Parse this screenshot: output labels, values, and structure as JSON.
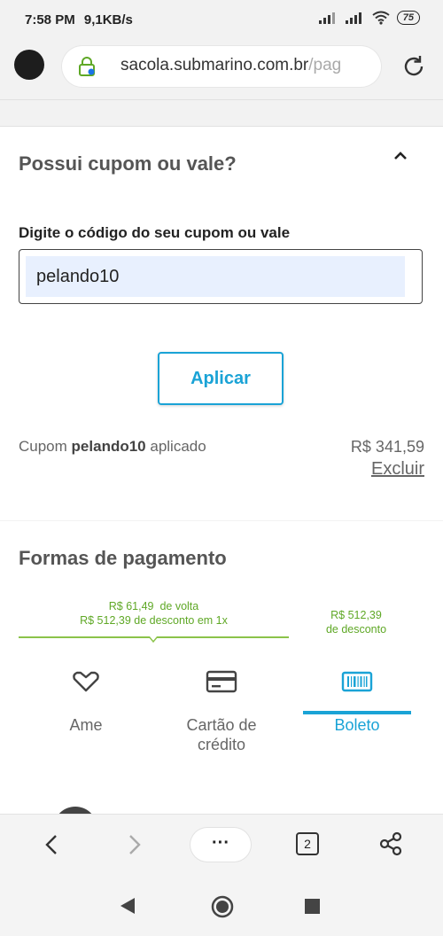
{
  "status_bar": {
    "time": "7:58 PM",
    "network_speed": "9,1KB/s",
    "battery": "75"
  },
  "browser": {
    "url_main": "sacola.submarino.com.br",
    "url_rest": "/pag"
  },
  "coupon": {
    "title": "Possui cupom ou vale?",
    "field_label": "Digite o código do seu cupom ou vale",
    "field_value": "pelando10",
    "apply_label": "Aplicar",
    "applied_prefix": "Cupom",
    "applied_code": "pelando10",
    "applied_suffix": "aplicado",
    "applied_value": "R$ 341,59",
    "remove_label": "Excluir"
  },
  "payment": {
    "title": "Formas de pagamento",
    "ame_promo_cashback": "R$ 61,49",
    "ame_promo_cashback_suffix": "de volta",
    "ame_promo_discount": "R$ 512,39 de desconto em 1x",
    "boleto_promo_value": "R$ 512,39",
    "boleto_promo_suffix": "de desconto",
    "tabs": [
      {
        "label": "Ame",
        "icon": "ame-heart-icon"
      },
      {
        "label": "Cartão de crédito",
        "icon": "credit-card-icon"
      },
      {
        "label": "Boleto",
        "icon": "barcode-icon",
        "selected": true
      }
    ]
  },
  "toolbar": {
    "menu_label": "···",
    "tab_count": "2"
  },
  "colors": {
    "accent": "#1aa3d6",
    "promo_green": "#5fa826"
  }
}
